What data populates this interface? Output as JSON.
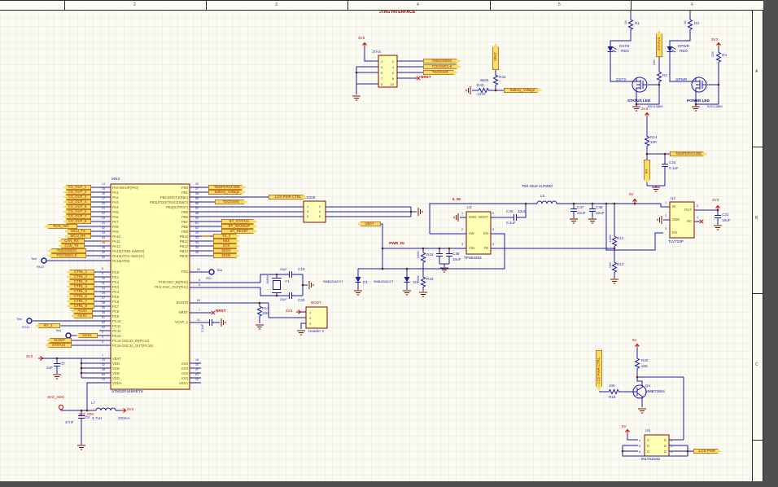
{
  "sheet": {
    "zone_cols": [
      "2",
      "3",
      "4",
      "5",
      "6"
    ],
    "zone_rows": [
      "A",
      "B",
      "C"
    ]
  },
  "jtag": {
    "title": "JTAG INTERFACE",
    "ref": "JTAG",
    "pins_left": "1\n3\n5\n7\n9",
    "pins_right": "2\n4\n6\n8\n10",
    "ports": [
      "TMS/SWDIO",
      "TCK/SWCLK",
      "TDO/SWO"
    ],
    "nrst": "NRST",
    "pwr": "3V3"
  },
  "batt_sense": {
    "port": "VBAT",
    "r_top_ref": "R42",
    "r_top_val": "953K",
    "r_bot_ref": "R40",
    "r_bot_val": "137K",
    "out": "Battery_Voltage"
  },
  "status_led": {
    "pwr": "3V3",
    "r_ref": "R1",
    "r_val": "1K",
    "led_ref": "DSTB",
    "led_color": "RED",
    "port": "STATUS",
    "rg_ref": "R2",
    "rg_val": "10K",
    "q_ref": "QSTS",
    "title": "STATUS LED",
    "part": "BSS138BK"
  },
  "power_led": {
    "pwr": "5V",
    "r_ref": "R3",
    "r_val": "1K",
    "led_ref": "DPWR",
    "led_color": "RED",
    "pull": "3V3",
    "rg_ref": "R4",
    "rg_val": "10K",
    "q_ref": "QPWR",
    "title": "POWER LED",
    "part": "BSS138BK"
  },
  "mcu": {
    "ref": "MN3",
    "part": "STM32F446RET6",
    "pa": [
      {
        "n": "PA0-WKUP(PA0)",
        "p": "14"
      },
      {
        "n": "PA1",
        "p": "15"
      },
      {
        "n": "PA2",
        "p": "16"
      },
      {
        "n": "PA3",
        "p": "17"
      },
      {
        "n": "PA4",
        "p": "20"
      },
      {
        "n": "PA5",
        "p": "21"
      },
      {
        "n": "PA6",
        "p": "22"
      },
      {
        "n": "PA7",
        "p": "23"
      },
      {
        "n": "PA8",
        "p": "41"
      },
      {
        "n": "PA9",
        "p": "42"
      },
      {
        "n": "PA10",
        "p": "43"
      },
      {
        "n": "PA11",
        "p": "44"
      },
      {
        "n": "PA12",
        "p": "45"
      },
      {
        "n": "PA13(JTMS-SWDIO)",
        "p": "46"
      },
      {
        "n": "PA14(JTCK-SWCLK)",
        "p": "49"
      },
      {
        "n": "PA15(JTDI)",
        "p": "50"
      }
    ],
    "pc": [
      {
        "n": "PC0",
        "p": "8"
      },
      {
        "n": "PC1",
        "p": "9"
      },
      {
        "n": "PC2",
        "p": "10"
      },
      {
        "n": "PC3",
        "p": "11"
      },
      {
        "n": "PC4",
        "p": "24"
      },
      {
        "n": "PC5",
        "p": "25"
      },
      {
        "n": "PC6",
        "p": "37"
      },
      {
        "n": "PC7",
        "p": "38"
      },
      {
        "n": "PC8",
        "p": "39"
      },
      {
        "n": "PC9",
        "p": "40"
      },
      {
        "n": "PC10",
        "p": "51"
      },
      {
        "n": "PC11",
        "p": "52"
      },
      {
        "n": "PC12",
        "p": "53"
      },
      {
        "n": "PC13",
        "p": "2"
      },
      {
        "n": "PC14-OSC32_IN(PC14)",
        "p": "3"
      },
      {
        "n": "PC15-OSC32_OUT(PC15)",
        "p": "4"
      }
    ],
    "pwr_left": [
      {
        "n": "VBAT",
        "p": "1"
      },
      {
        "n": "VDD",
        "p": "19"
      },
      {
        "n": "VDD",
        "p": "32"
      },
      {
        "n": "VDD",
        "p": "48"
      },
      {
        "n": "VDD",
        "p": "64"
      },
      {
        "n": "VDDA",
        "p": "13"
      }
    ],
    "pb": [
      {
        "n": "PB0",
        "p": "26"
      },
      {
        "n": "PB1",
        "p": "27"
      },
      {
        "n": "PB2-BOOT1(PB2)",
        "p": "28"
      },
      {
        "n": "PB3(JTDO/TRACESWO)",
        "p": "55"
      },
      {
        "n": "PB4(NJTRST)",
        "p": "56"
      },
      {
        "n": "PB5",
        "p": "57"
      },
      {
        "n": "PB6",
        "p": "58"
      },
      {
        "n": "PB7",
        "p": "59"
      },
      {
        "n": "PB8",
        "p": "61"
      },
      {
        "n": "PB9",
        "p": "62"
      },
      {
        "n": "PB10",
        "p": "29"
      },
      {
        "n": "PB12",
        "p": "33"
      },
      {
        "n": "PB13",
        "p": "34"
      },
      {
        "n": "PB14",
        "p": "35"
      },
      {
        "n": "PB15",
        "p": "36"
      }
    ],
    "pd2": {
      "n": "PD2",
      "p": "54"
    },
    "ph0": {
      "n": "PH0-OSC_IN(PH0)",
      "p": "5"
    },
    "ph1": {
      "n": "PH1-OSC_OUT(PH1)",
      "p": "6"
    },
    "boot0": {
      "n": "BOOT0",
      "p": "60"
    },
    "nrst": {
      "n": "NRST",
      "p": "7"
    },
    "vcap": {
      "n": "VCAP_1",
      "p": "31"
    },
    "pwr_right": [
      {
        "n": "VSS",
        "p": "18"
      },
      {
        "n": "VSS",
        "p": "30"
      },
      {
        "n": "VSS",
        "p": "47"
      },
      {
        "n": "VSS",
        "p": "63"
      },
      {
        "n": "VSSA",
        "p": "12"
      }
    ]
  },
  "left_ports": {
    "cs_out": [
      "CS_OUT_1",
      "CS_OUT_2",
      "CS_OUT_3",
      "CS_OUT_4",
      "CS_OUT_5",
      "CS_OUT_6",
      "CS_OUT_7",
      "CS_OUT_8"
    ],
    "run_sig": "RUN_SIG",
    "uart": [
      "MCU_TX",
      "MCU_RX"
    ],
    "can": [
      "CAN_RX",
      "CAN_TX"
    ],
    "swd": [
      "TMS/SWDIO",
      "TCK/SWCLK"
    ],
    "ctrl": [
      "CTRL_1",
      "CTRL_2",
      "CTRL_3",
      "CTRL_4",
      "CTRL_5",
      "CTRL_6",
      "CTRL_7",
      "CTRL_8"
    ],
    "aux": [
      "AUX1",
      "AUX2"
    ],
    "rx3": "RX_3",
    "nss2": "NSS2",
    "sleep": "SLEEP",
    "status": "STATUS",
    "test": "Test",
    "tp_pa15": "PA15",
    "tp_pc10": "PC10",
    "tp_pc13": "PC13"
  },
  "right_ports": {
    "temperature": "TEMPERATURE",
    "battery": "Battery_Voltage",
    "tdo": "TDO/SWO",
    "lcd_ctrl": "LCD PWR CTRL",
    "bt": [
      "BT_STATUS",
      "BT_WAKEUP",
      "BT_RESET"
    ],
    "spi": [
      "TX_3",
      "NSS",
      "SCK",
      "MISO",
      "MOSI"
    ],
    "test": "Test",
    "tp_pd2": "PD2"
  },
  "mode": {
    "ref": "MODE",
    "pins_left": "1\n3\n5",
    "pins_right": "2\n4\n6"
  },
  "crystal": {
    "ref": "Y1",
    "freq": "8MHz",
    "c_top_ref": "C19",
    "c_top_val": "20pF",
    "c_bot_ref": "C20",
    "c_bot_val": "20pF"
  },
  "reset": {
    "label": "NRST",
    "vcap_val": "2.2uF"
  },
  "boot": {
    "title": "BOOT",
    "pwr": "3V3",
    "r_ref": "R17",
    "r_val": "10K",
    "pins": "1\n2\n3",
    "part": "Header 3"
  },
  "pwr_in": {
    "vbat": "VBAT",
    "net": "PWR_IN",
    "d1_part": "SMBJ20ACCT",
    "d1_ref": "D1",
    "d2_part": "SMBJ20ACCT",
    "d2_ref": "D2",
    "r_top_ref": "R15",
    "r_top_val": "100K",
    "r_bot_ref": "R16",
    "r_bot_val": "100K",
    "c2_ref": "C38",
    "c2_val": "10uF"
  },
  "buck": {
    "ref": "U1",
    "part": "TPS54202",
    "net_in": "5_IN",
    "pins_left": [
      "GND",
      "SW",
      "VIN"
    ],
    "pins_right": [
      "BOOT",
      "EN",
      "FB"
    ],
    "nums_left": [
      "1",
      "2",
      "3"
    ],
    "nums_right": [
      "6",
      "5",
      "4"
    ],
    "cboot_ref": "C40",
    "cboot_val": "0.1uF",
    "l_ref": "L5",
    "l_val": "33uH",
    "l_note": "TDK 33uH VLF5040",
    "cout1_ref": "C37",
    "cout1_val": "22uF",
    "cout2_ref": "C39",
    "cout2_val": "22uF",
    "rfb1_ref": "R12",
    "rfb1_val": "100K",
    "rfb2_ref": "R13",
    "rfb2_val": "13K",
    "out": "5V"
  },
  "ldo": {
    "ref": "U2",
    "part": "TLV733P",
    "pins_left": [
      "IN",
      "GND",
      "EN"
    ],
    "pins_right": [
      "OUT",
      "NC"
    ],
    "nums_left": [
      "1",
      "2",
      "3"
    ],
    "nums_right": [
      "5",
      "4"
    ],
    "out": "3V3",
    "c_ref": "C21",
    "c_val": "10uF"
  },
  "temp": {
    "pwr": "3V3",
    "r_ref": "R14",
    "r_val": "10K",
    "port": "TEMPERATURE",
    "rt": "RT",
    "c_ref": "C34",
    "c_val": "0.1uF"
  },
  "vdd_rail": {
    "pwr": "3V3",
    "c_ref": "C7",
    "c_val": "1uF"
  },
  "adc_rail": {
    "port": "3V3_ADC",
    "net": "3V3_ADC",
    "l_ref": "L7",
    "l_val": "4.7uH",
    "l_cur": "200mA",
    "c_ref": "C8",
    "c_val": "47nF",
    "out": "3V3"
  },
  "lcd_pwr": {
    "pwr": "5V",
    "r_top_ref": "R20",
    "r_top_val": "10K",
    "rb_val": "10K",
    "rb_ref": "R18",
    "q_ref": "Q1",
    "q_part": "MMBT3904",
    "u_ref": "U6",
    "u_part": "IRLTS2242",
    "u_pins_left": "S\nD\nD",
    "u_pins_right": "G\nD\nD",
    "u_nums_left": "4\n5\n6",
    "u_nums_right": "3\n2\n1",
    "src_pwr": "5V",
    "out": "LCD PWR"
  },
  "colors": {
    "wire": "#1b1ba8",
    "port_fill": "#f7df66",
    "port_text": "#8f1a00",
    "ic_fill": "#ffffb5",
    "ic_border": "#7c0b0b",
    "net_red": "#cc0000",
    "designator_blue": "#2626c9",
    "gnd": "#7c1500",
    "highlight_orange": "#e8721c",
    "sheet_bg": "#fbfbf3",
    "outer": "#4f4f4f"
  }
}
